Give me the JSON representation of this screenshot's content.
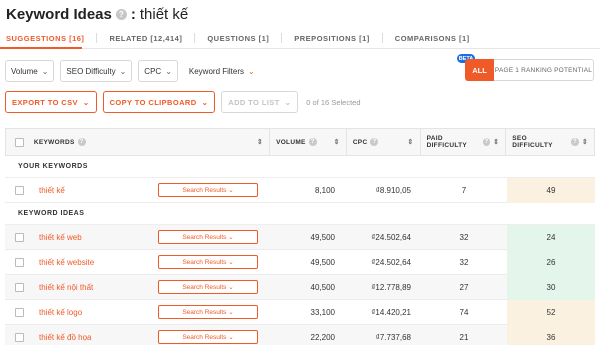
{
  "header": {
    "title": "Keyword Ideas",
    "help": "?",
    "colon": ":",
    "keyword": "thiết kế"
  },
  "tabs": [
    {
      "label": "SUGGESTIONS [16]",
      "active": true
    },
    {
      "label": "RELATED [12,414]",
      "active": false
    },
    {
      "label": "QUESTIONS [1]",
      "active": false
    },
    {
      "label": "PREPOSITIONS [1]",
      "active": false
    },
    {
      "label": "COMPARISONS [1]",
      "active": false
    }
  ],
  "filters": {
    "volume": "Volume",
    "seo_difficulty": "SEO Difficulty",
    "cpc": "CPC",
    "keyword_filters": "Keyword Filters",
    "chevron": "⌄"
  },
  "toggle": {
    "beta": "BETA",
    "all": "ALL",
    "rank": "PAGE 1 RANKING POTENTIAL"
  },
  "actions": {
    "export": "EXPORT TO CSV",
    "copy": "COPY TO CLIPBOARD",
    "add": "ADD TO LIST",
    "selected": "0 of 16 Selected",
    "chevron": "⌄"
  },
  "table": {
    "columns": {
      "keywords": "KEYWORDS",
      "volume": "VOLUME",
      "cpc": "CPC",
      "paid_difficulty": "PAID DIFFICULTY",
      "seo_difficulty": "SEO DIFFICULTY",
      "help": "?",
      "sort": "⇕"
    },
    "sections": {
      "your_keywords": "YOUR KEYWORDS",
      "keyword_ideas": "KEYWORD IDEAS"
    },
    "serp_label": "Search Results ⌄",
    "your_keywords": [
      {
        "keyword": "thiết kế",
        "volume": "8,100",
        "cpc": "₫8.910,05",
        "pd": "7",
        "sd": "49",
        "sd_color": "#fbf1e0"
      }
    ],
    "keyword_ideas": [
      {
        "keyword": "thiết kế web",
        "volume": "49,500",
        "cpc": "₫24.502,64",
        "pd": "32",
        "sd": "24",
        "sd_color": "#e4f5ec"
      },
      {
        "keyword": "thiết kế website",
        "volume": "49,500",
        "cpc": "₫24.502,64",
        "pd": "32",
        "sd": "26",
        "sd_color": "#e4f5ec"
      },
      {
        "keyword": "thiết kế nội thất",
        "volume": "40,500",
        "cpc": "₫12.778,89",
        "pd": "27",
        "sd": "30",
        "sd_color": "#e4f5ec"
      },
      {
        "keyword": "thiết kế logo",
        "volume": "33,100",
        "cpc": "₫14.420,21",
        "pd": "74",
        "sd": "52",
        "sd_color": "#fbf1e0"
      },
      {
        "keyword": "thiết kế đồ họa",
        "volume": "22,200",
        "cpc": "₫7.737,68",
        "pd": "21",
        "sd": "36",
        "sd_color": "#fbf1e0"
      }
    ]
  },
  "colors": {
    "accent": "#f05a28",
    "beta": "#1d6fe0",
    "easy": "#e4f5ec",
    "medium": "#fbf1e0"
  }
}
